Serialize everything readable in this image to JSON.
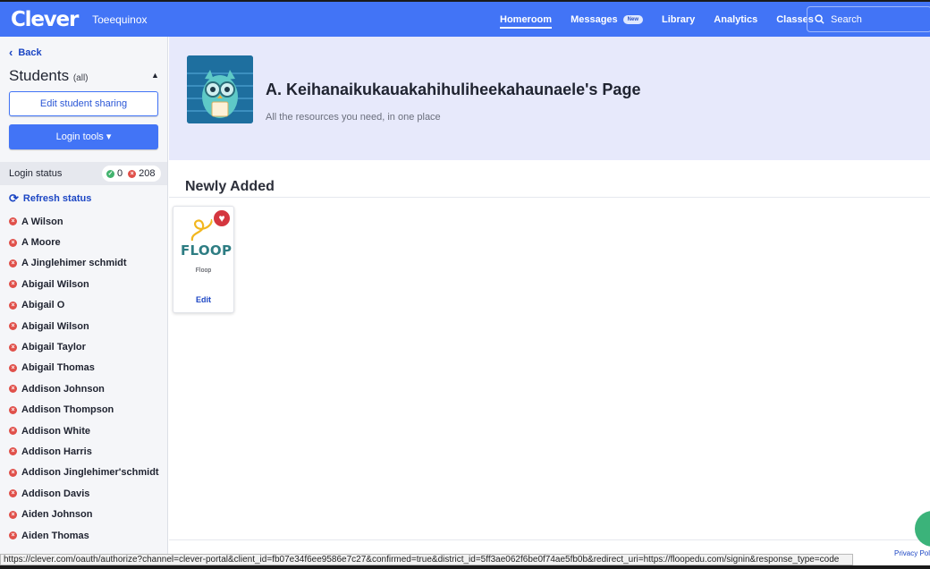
{
  "header": {
    "logo": "Clever",
    "district": "Toeequinox",
    "nav": [
      {
        "label": "Homeroom",
        "active": true
      },
      {
        "label": "Messages",
        "badge": "New"
      },
      {
        "label": "Library"
      },
      {
        "label": "Analytics"
      },
      {
        "label": "Classes"
      }
    ],
    "search_placeholder": "Search"
  },
  "sidebar": {
    "back_label": "Back",
    "title": "Students",
    "title_suffix": "(all)",
    "edit_sharing_label": "Edit student sharing",
    "login_tools_label": "Login tools ▾",
    "login_status_label": "Login status",
    "count_ok": "0",
    "count_bad": "208",
    "refresh_label": "Refresh status",
    "students": [
      "A Wilson",
      "A Moore",
      "A Jinglehimer schmidt",
      "Abigail Wilson",
      "Abigail O",
      "Abigail Wilson",
      "Abigail Taylor",
      "Abigail Thomas",
      "Addison Johnson",
      "Addison Thompson",
      "Addison White",
      "Addison Harris",
      "Addison Jinglehimer'schmidt",
      "Addison Davis",
      "Aiden Johnson",
      "Aiden Thomas"
    ]
  },
  "hero": {
    "title": "A. Keihanaikukauakahihuliheekahaunaele's Page",
    "subtitle": "All the resources you need, in one place"
  },
  "main": {
    "section_title": "Newly Added",
    "card": {
      "logo_text": "FLOOP",
      "name": "Floop",
      "edit_label": "Edit"
    }
  },
  "footer": {
    "privacy": "Privacy Poli"
  },
  "statusbar": {
    "url": "https://clever.com/oauth/authorize?channel=clever-portal&client_id=fb07e34f6ee9586e7c27&confirmed=true&district_id=5ff3ae062f6be0f74ae5fb0b&redirect_uri=https://floopedu.com/signin&response_type=code"
  },
  "colors": {
    "brand": "#4274f6",
    "hero_bg": "#e7e9fb",
    "ok": "#42b36e",
    "bad": "#e0504a",
    "favorite": "#d4363f"
  }
}
